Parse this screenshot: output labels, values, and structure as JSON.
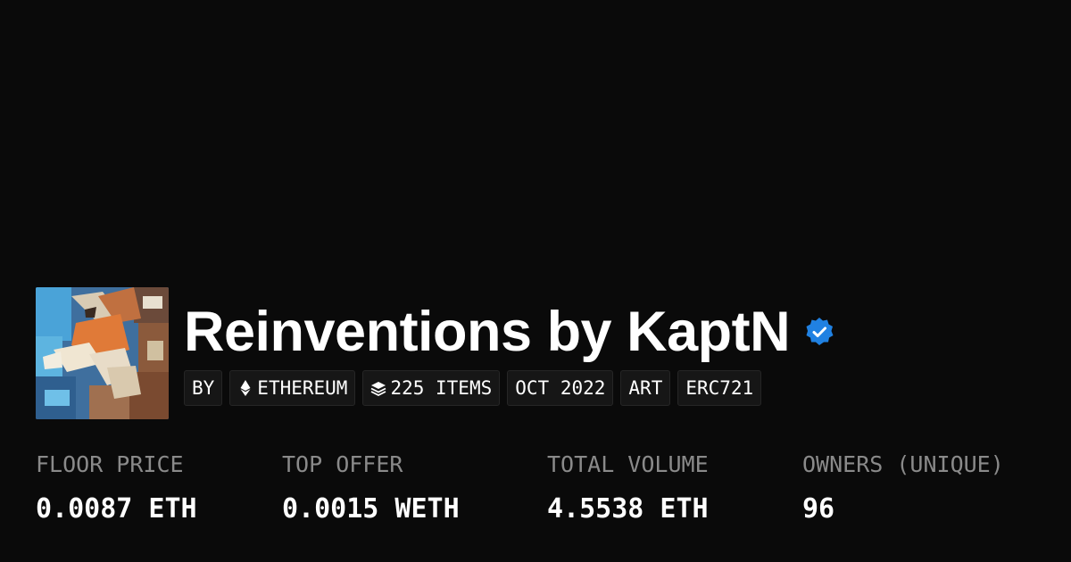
{
  "collection": {
    "title": "Reinventions by KaptN",
    "verified_icon": "verified-badge-icon",
    "badge_color": "#2081e2",
    "thumbnail_icon": "collage-fox-artwork-icon"
  },
  "chips": [
    {
      "label": "BY",
      "icon": null
    },
    {
      "label": "ETHEREUM",
      "icon": "ethereum-icon"
    },
    {
      "label": "225 ITEMS",
      "icon": "layers-icon"
    },
    {
      "label": "OCT 2022",
      "icon": null
    },
    {
      "label": "ART",
      "icon": null
    },
    {
      "label": "ERC721",
      "icon": null
    }
  ],
  "stats": [
    {
      "label": "FLOOR PRICE",
      "value": "0.0087 ETH"
    },
    {
      "label": "TOP OFFER",
      "value": "0.0015 WETH"
    },
    {
      "label": "TOTAL VOLUME",
      "value": "4.5538 ETH"
    },
    {
      "label": "OWNERS (UNIQUE)",
      "value": "96"
    }
  ],
  "colors": {
    "background": "#0a0a0a",
    "label": "#8a8a8a",
    "text": "#ffffff"
  }
}
